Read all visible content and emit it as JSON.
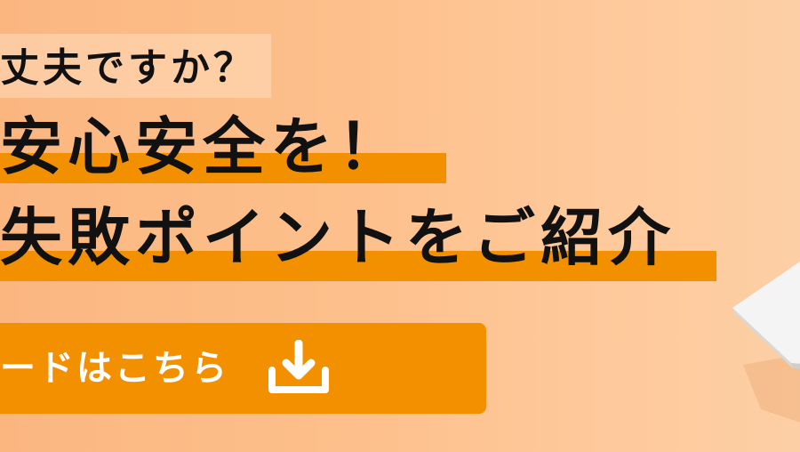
{
  "banner": {
    "question": "丈夫ですか？",
    "headline_line1": "安心安全を！",
    "headline_line2": "失敗ポイントをご紹介",
    "cta_label": "ードはこちら",
    "icon": "download-icon",
    "colors": {
      "background": "#fdc08c",
      "accent": "#f29000",
      "text": "#111111",
      "button_text": "#ffffff"
    }
  }
}
